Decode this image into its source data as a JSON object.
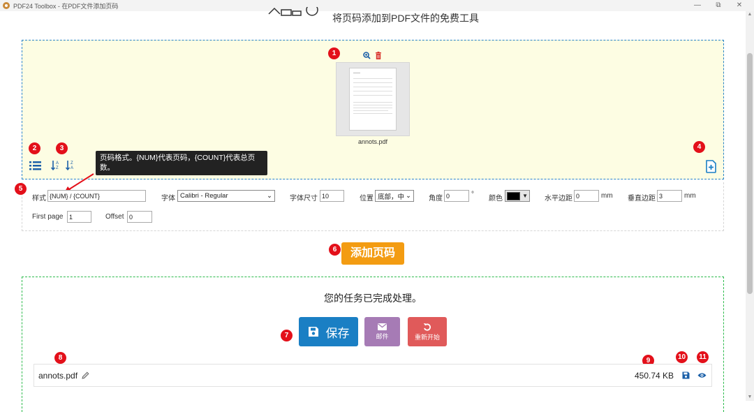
{
  "window": {
    "title": "PDF24 Toolbox - 在PDF文件添加页码",
    "minimize": "—",
    "restore": "⧉",
    "close": "✕"
  },
  "header": {
    "subtitle": "将页码添加到PDF文件的免费工具"
  },
  "markers": [
    "1",
    "2",
    "3",
    "4",
    "5",
    "6",
    "7",
    "8",
    "9",
    "10",
    "11"
  ],
  "file_card": {
    "filename": "annots.pdf",
    "zoom_icon": "zoom-in-icon",
    "delete_icon": "trash-icon"
  },
  "tooltip": {
    "text": "页码格式。{NUM}代表页码，{COUNT}代表总页数。"
  },
  "options": {
    "style_label": "样式",
    "style_value": "{NUM} / {COUNT}",
    "font_label": "字体",
    "font_value": "Calibri - Regular",
    "size_label": "字体尺寸",
    "size_value": "10",
    "position_label": "位置",
    "position_value": "底部，中",
    "angle_label": "角度",
    "angle_value": "0",
    "angle_unit": "°",
    "color_label": "颜色",
    "color_value": "#000000",
    "hmargin_label": "水平边距",
    "hmargin_value": "0",
    "hmargin_unit": "mm",
    "vmargin_label": "垂直边距",
    "vmargin_value": "3",
    "vmargin_unit": "mm",
    "first_page_label": "First page",
    "first_page_value": "1",
    "offset_label": "Offset",
    "offset_value": "0"
  },
  "actions": {
    "add_button": "添加页码"
  },
  "result": {
    "message": "您的任务已完成处理。",
    "save_label": "保存",
    "email_label": "邮件",
    "restart_label": "重新开始",
    "file_name": "annots.pdf",
    "file_size": "450.74 KB"
  },
  "colors": {
    "accent_blue": "#1a7fc4",
    "orange": "#f39c12",
    "purple": "#a67bb5",
    "red": "#e05a5a",
    "badge_red": "#e3101a"
  }
}
